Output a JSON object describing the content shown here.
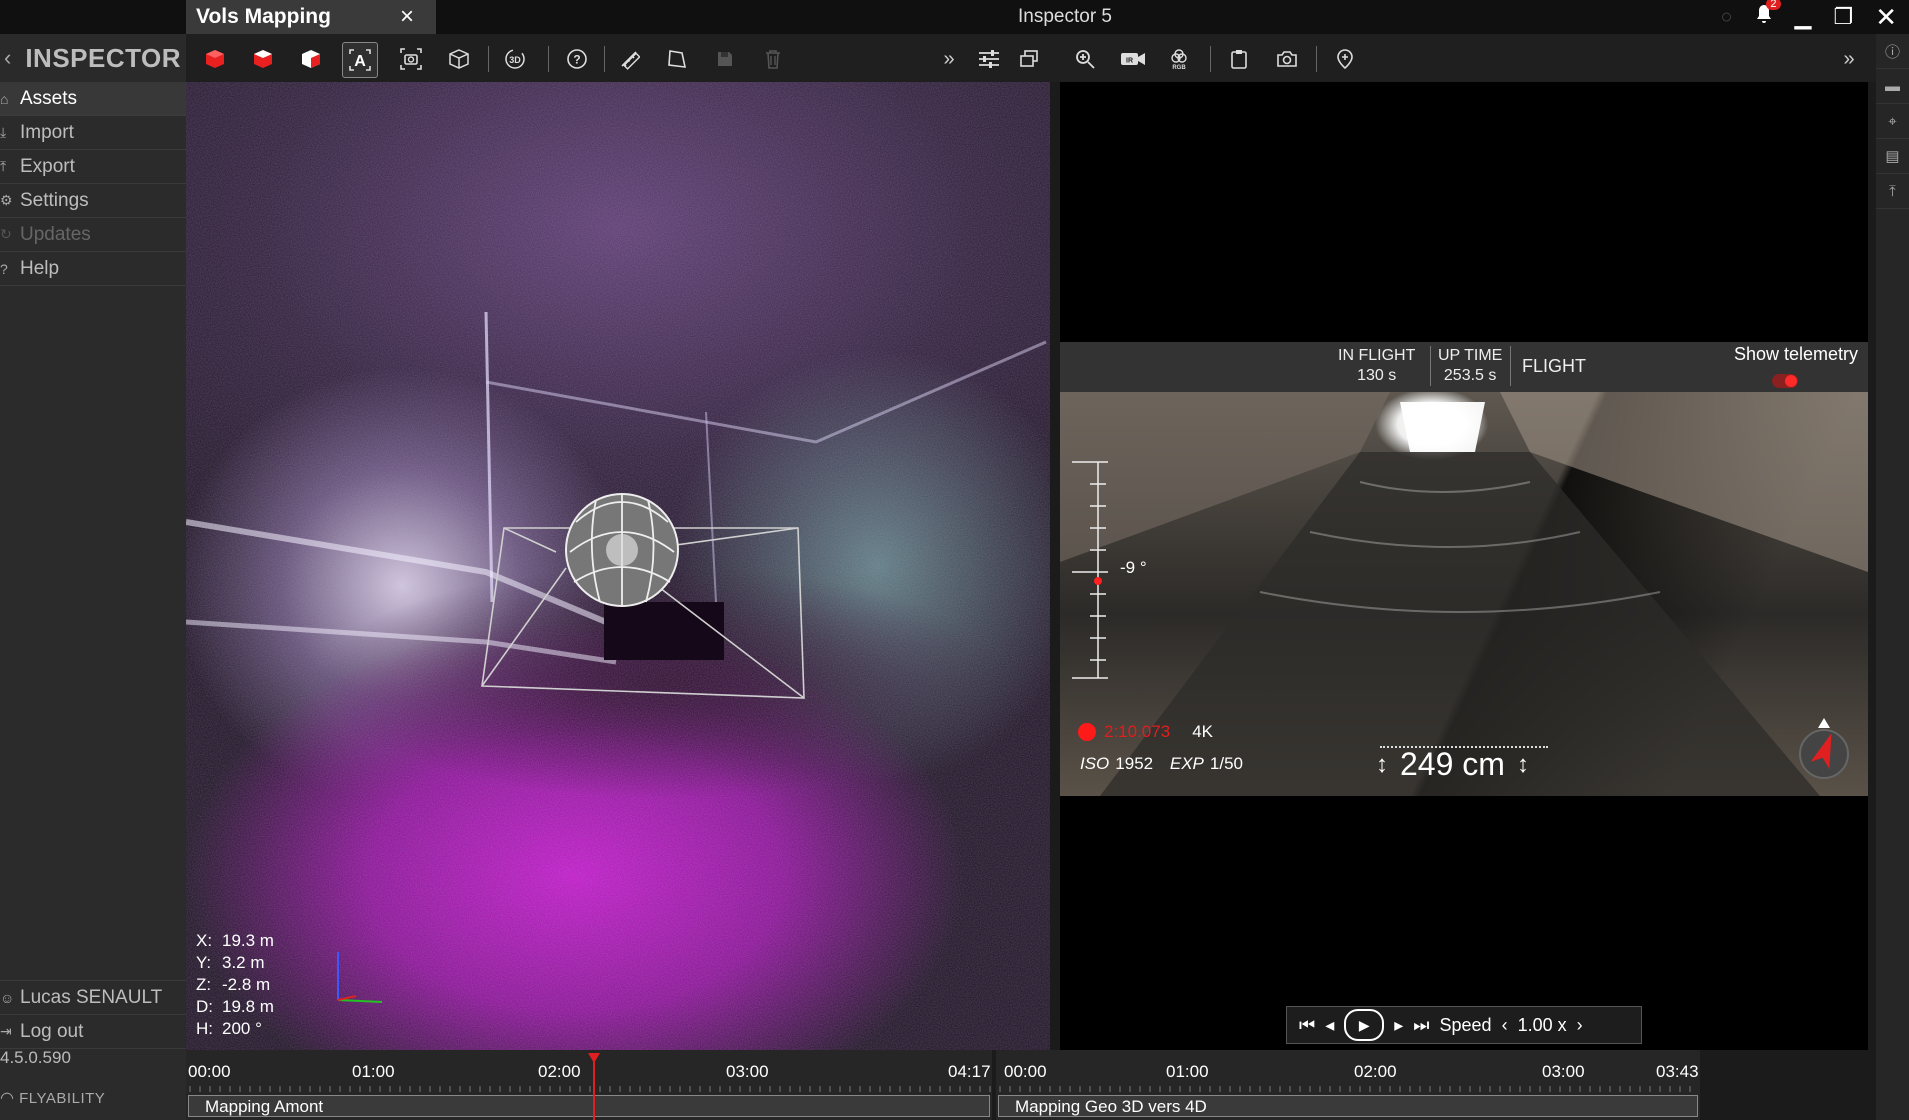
{
  "window": {
    "app_title": "Inspector 5",
    "tab_title": "Vols Mapping",
    "tab_close": "×",
    "notifications_badge": "2"
  },
  "brand": {
    "name": "INSPECTOR",
    "back_glyph": "‹"
  },
  "sidebar": {
    "items": [
      {
        "label": "Assets",
        "icon": "home-icon"
      },
      {
        "label": "Import",
        "icon": "download-icon"
      },
      {
        "label": "Export",
        "icon": "upload-icon"
      },
      {
        "label": "Settings",
        "icon": "gear-icon"
      },
      {
        "label": "Updates",
        "icon": "refresh-icon"
      },
      {
        "label": "Help",
        "icon": "help-icon"
      }
    ],
    "user": "Lucas SENAULT",
    "logout": "Log out",
    "version": "4.5.0.590",
    "company": "FLYABILITY"
  },
  "view3d": {
    "coords": [
      {
        "axis": "X:",
        "value": "19.3 m"
      },
      {
        "axis": "Y:",
        "value": "3.2 m"
      },
      {
        "axis": "Z:",
        "value": "-2.8 m"
      },
      {
        "axis": "D:",
        "value": "19.8 m"
      },
      {
        "axis": "H:",
        "value": "200 °"
      }
    ]
  },
  "video": {
    "telemetry": {
      "in_flight_label": "IN FLIGHT",
      "in_flight_value": "130 s",
      "up_time_label": "UP TIME",
      "up_time_value": "253.5 s",
      "mode": "FLIGHT",
      "show_telemetry": "Show telemetry"
    },
    "pitch": "-9 °",
    "rec_time": "2:10.073",
    "resolution": "4K",
    "iso_label": "ISO",
    "iso_value": "1952",
    "exp_label": "EXP",
    "exp_value": "1/50",
    "distance": "249 cm",
    "speed_label": "Speed",
    "speed_value": "1.00 x"
  },
  "timeline1": {
    "labels": [
      "00:00",
      "01:00",
      "02:00",
      "03:00",
      "04:17"
    ],
    "track": "Mapping Amont"
  },
  "timeline2": {
    "labels": [
      "00:00",
      "01:00",
      "02:00",
      "03:00",
      "03:43"
    ],
    "track": "Mapping Geo 3D vers 4D"
  },
  "colors": {
    "accent": "#e02020",
    "background": "#1b1b1b"
  }
}
